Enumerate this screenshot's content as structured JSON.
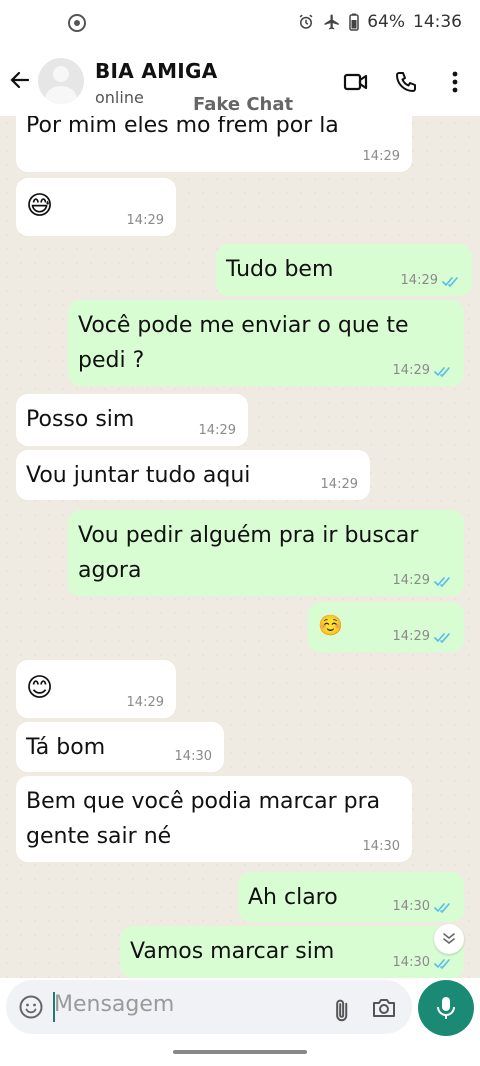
{
  "status_bar": {
    "battery": "64%",
    "time": "14:36"
  },
  "header": {
    "name": "BIA AMIGA",
    "status": "online",
    "watermark": "Fake Chat"
  },
  "messages": [
    {
      "dir": "in",
      "text": "Por mim eles mo frem por la",
      "time": "14:29"
    },
    {
      "dir": "in",
      "emoji": "😅",
      "time": "14:29"
    },
    {
      "dir": "out",
      "text": "Tudo bem",
      "time": "14:29"
    },
    {
      "dir": "out",
      "text": "Você pode me enviar o que te",
      "text2": "pedi ?",
      "time": "14:29"
    },
    {
      "dir": "in",
      "text": "Posso sim",
      "time": "14:29"
    },
    {
      "dir": "in",
      "text": "Vou juntar tudo aqui",
      "time": "14:29"
    },
    {
      "dir": "out",
      "text": "Vou pedir alguém pra ir buscar",
      "text2": "agora",
      "time": "14:29"
    },
    {
      "dir": "out",
      "emoji": "☺️",
      "time": "14:29"
    },
    {
      "dir": "in",
      "emoji": "😊",
      "time": "14:29"
    },
    {
      "dir": "in",
      "text": "Tá bom",
      "time": "14:30"
    },
    {
      "dir": "in",
      "text": "Bem que você podia marcar pra",
      "text2": "gente sair né",
      "time": "14:30"
    },
    {
      "dir": "out",
      "text": "Ah claro",
      "time": "14:30"
    },
    {
      "dir": "out",
      "text": "Vamos marcar sim",
      "time": "14:30"
    }
  ],
  "input": {
    "placeholder": "Mensagem"
  },
  "icons": {
    "back": "arrow-left-icon",
    "video": "video-call-icon",
    "call": "phone-icon",
    "menu": "more-vert-icon",
    "emoji": "emoji-icon",
    "attach": "paperclip-icon",
    "camera": "camera-icon",
    "mic": "microphone-icon",
    "scroll": "double-chevron-down-icon"
  },
  "colors": {
    "outgoing": "#d9fdd3",
    "incoming": "#ffffff",
    "read_tick": "#53bdeb",
    "accent": "#1a8a74",
    "chat_bg": "#efeae2"
  }
}
